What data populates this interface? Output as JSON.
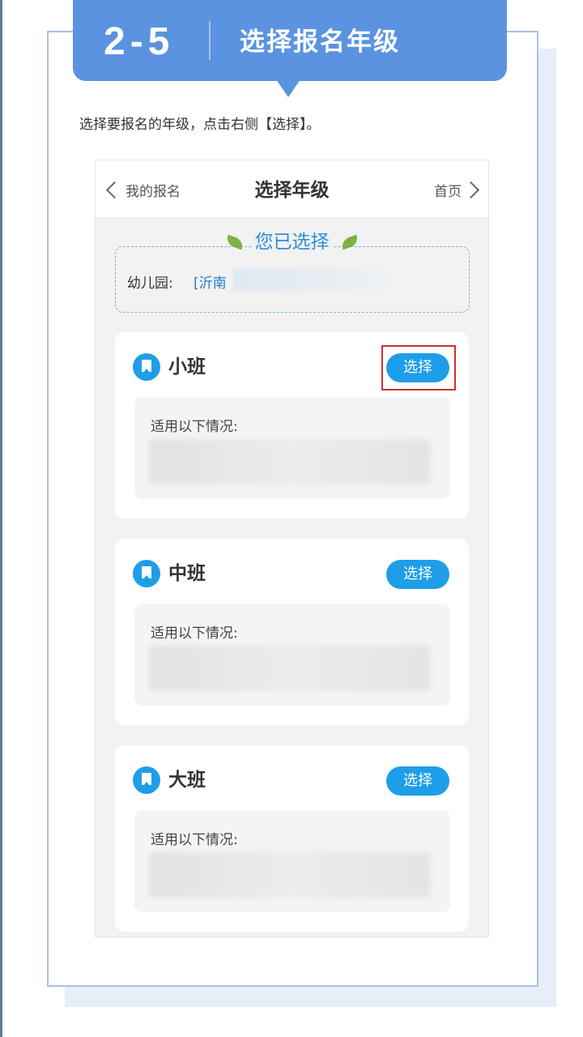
{
  "banner": {
    "step": "2-5",
    "title": "选择报名年级"
  },
  "instruction": "选择要报名的年级，点击右侧【选择】。",
  "phone": {
    "nav": {
      "back_label": "我的报名",
      "title": "选择年级",
      "home_label": "首页"
    },
    "selected": {
      "title": "您已选择",
      "label": "幼儿园:",
      "value": "[沂南"
    },
    "grades": [
      {
        "name": "小班",
        "button": "选择",
        "condition_label": "适用以下情况:"
      },
      {
        "name": "中班",
        "button": "选择",
        "condition_label": "适用以下情况:"
      },
      {
        "name": "大班",
        "button": "选择",
        "condition_label": "适用以下情况:"
      }
    ]
  },
  "colors": {
    "banner": "#5b93e0",
    "accent": "#1e9ee8",
    "highlight": "#d62d2d"
  }
}
